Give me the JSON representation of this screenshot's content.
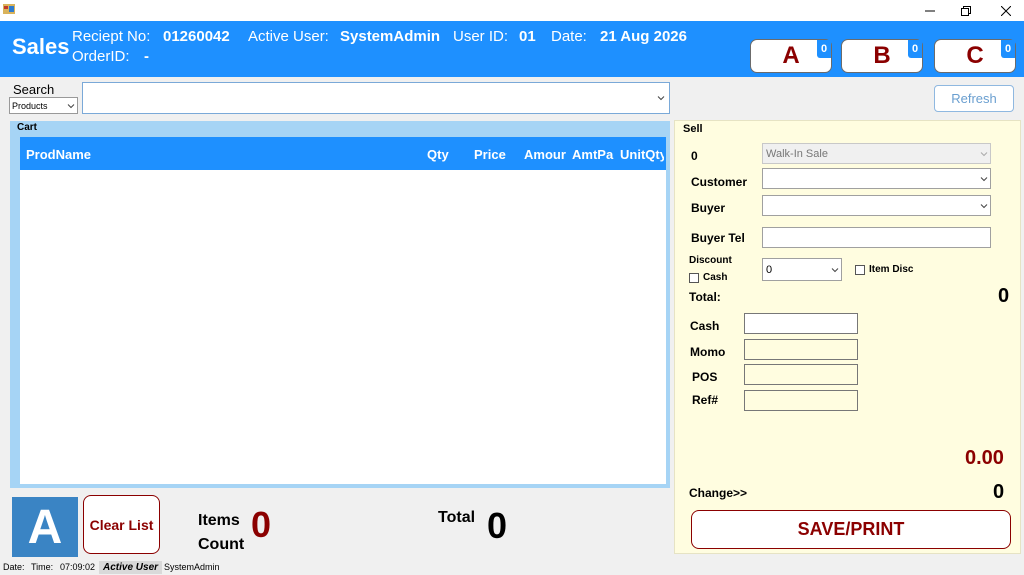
{
  "header": {
    "title": "Sales",
    "receipt_label": "Reciept No:",
    "receipt_no": "01260042",
    "active_user_label": "Active User:",
    "active_user": "SystemAdmin",
    "user_id_label": "User ID:",
    "user_id": "01",
    "date_label": "Date:",
    "date": "21 Aug 2026",
    "order_id_label": "OrderID:",
    "order_id": "-",
    "tabs": [
      {
        "label": "A",
        "count": "0"
      },
      {
        "label": "B",
        "count": "0"
      },
      {
        "label": "C",
        "count": "0"
      }
    ]
  },
  "search": {
    "label": "Search",
    "type_value": "Products",
    "query": ""
  },
  "refresh_label": "Refresh",
  "cart": {
    "label": "Cart",
    "columns": [
      "ProdName",
      "Qty",
      "Price",
      "Amour",
      "AmtPa",
      "UnitQty"
    ],
    "rows": []
  },
  "bottom": {
    "cart_tag": "A",
    "clear_label": "Clear List",
    "items_label_1": "Items",
    "items_label_2": "Count",
    "items_count": "0",
    "total_label": "Total",
    "total_value": "0"
  },
  "sell": {
    "title": "Sell",
    "sale_type_label": "0",
    "sale_type_value": "Walk-In Sale",
    "customer_label": "Customer",
    "buyer_label": "Buyer",
    "buyer_tel_label": "Buyer Tel",
    "discount_label": "Discount",
    "cash_check_label": "Cash",
    "discount_value": "0",
    "item_disc_label": "Item Disc",
    "total_label": "Total:",
    "total_value": "0",
    "cash_label": "Cash",
    "momo_label": "Momo",
    "pos_label": "POS",
    "ref_label": "Ref#",
    "amount_value": "0.00",
    "change_label": "Change>>",
    "change_value": "0",
    "save_label": "SAVE/PRINT"
  },
  "status": {
    "date_label": "Date:",
    "time_label": "Time:",
    "time_value": "07:09:02",
    "active_user_label": "Active User",
    "active_user_value": "SystemAdmin"
  },
  "colors": {
    "header_blue": "#1e90ff",
    "dark_red": "#8b0000",
    "sell_panel_bg": "#fffde0",
    "cart_frame": "#a6d4f5"
  }
}
